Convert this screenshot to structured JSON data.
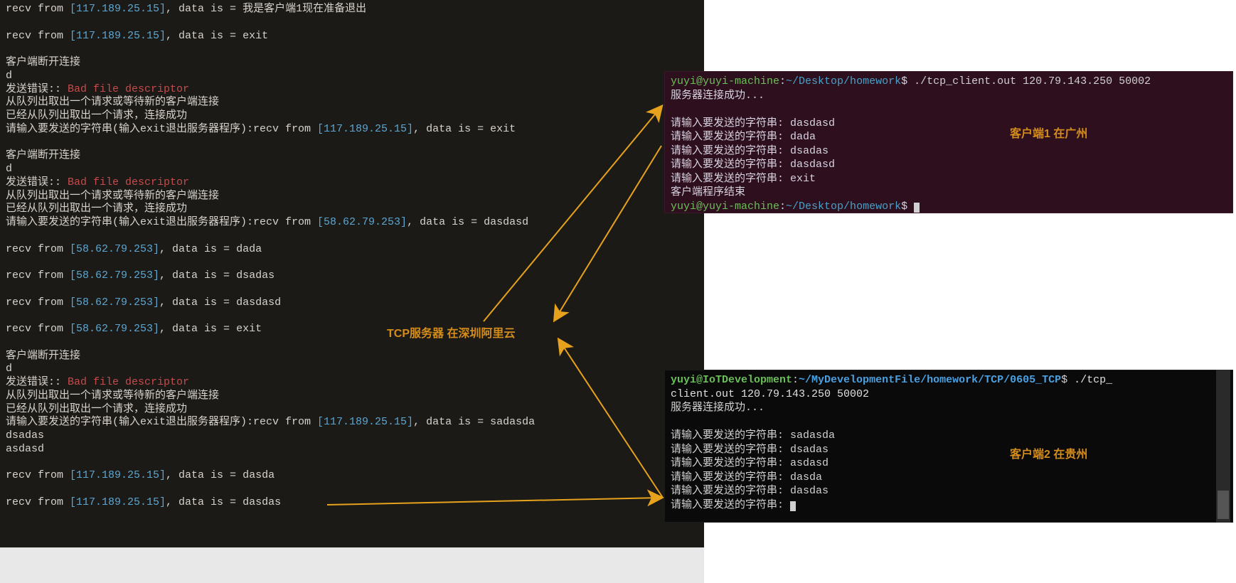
{
  "labels": {
    "server": "TCP服务器 在深圳阿里云",
    "client1": "客户端1 在广州",
    "client2": "客户端2 在贵州"
  },
  "ips": {
    "guizhou": "117.189.25.15",
    "guangzhou": "58.62.79.253",
    "server_addr": "120.79.143.250",
    "server_port": "50002"
  },
  "server_lines": [
    {
      "t": "recv",
      "ip": "117.189.25.15",
      "data": "我是客户端1现在准备退出"
    },
    {
      "t": "blank"
    },
    {
      "t": "recv",
      "ip": "117.189.25.15",
      "data": "exit"
    },
    {
      "t": "blank"
    },
    {
      "t": "plain",
      "text": "客户端断开连接"
    },
    {
      "t": "plain",
      "text": "d"
    },
    {
      "t": "err",
      "prefix": "发送错误::",
      "msg": " Bad file descriptor"
    },
    {
      "t": "plain",
      "text": "从队列出取出一个请求或等待新的客户端连接"
    },
    {
      "t": "plain",
      "text": "已经从队列出取出一个请求，连接成功"
    },
    {
      "t": "prompt_recv",
      "ip": "117.189.25.15",
      "data": "exit"
    },
    {
      "t": "blank"
    },
    {
      "t": "plain",
      "text": "客户端断开连接"
    },
    {
      "t": "plain",
      "text": "d"
    },
    {
      "t": "err",
      "prefix": "发送错误::",
      "msg": " Bad file descriptor"
    },
    {
      "t": "plain",
      "text": "从队列出取出一个请求或等待新的客户端连接"
    },
    {
      "t": "plain",
      "text": "已经从队列出取出一个请求，连接成功"
    },
    {
      "t": "prompt_recv",
      "ip": "58.62.79.253",
      "data": "dasdasd"
    },
    {
      "t": "blank"
    },
    {
      "t": "recv",
      "ip": "58.62.79.253",
      "data": "dada"
    },
    {
      "t": "blank"
    },
    {
      "t": "recv",
      "ip": "58.62.79.253",
      "data": "dsadas"
    },
    {
      "t": "blank"
    },
    {
      "t": "recv",
      "ip": "58.62.79.253",
      "data": "dasdasd"
    },
    {
      "t": "blank"
    },
    {
      "t": "recv",
      "ip": "58.62.79.253",
      "data": "exit"
    },
    {
      "t": "blank"
    },
    {
      "t": "plain",
      "text": "客户端断开连接"
    },
    {
      "t": "plain",
      "text": "d"
    },
    {
      "t": "err",
      "prefix": "发送错误::",
      "msg": " Bad file descriptor"
    },
    {
      "t": "plain",
      "text": "从队列出取出一个请求或等待新的客户端连接"
    },
    {
      "t": "plain",
      "text": "已经从队列出取出一个请求，连接成功"
    },
    {
      "t": "prompt_recv",
      "ip": "117.189.25.15",
      "data": "sadasda"
    },
    {
      "t": "plain",
      "text": "dsadas"
    },
    {
      "t": "plain",
      "text": "asdasd"
    },
    {
      "t": "blank"
    },
    {
      "t": "recv",
      "ip": "117.189.25.15",
      "data": "dasda"
    },
    {
      "t": "blank"
    },
    {
      "t": "recv",
      "ip": "117.189.25.15",
      "data": "dasdas"
    }
  ],
  "server_strings": {
    "recv_prefix": "recv from ",
    "data_is": ", data is = ",
    "prompt": "请输入要发送的字符串(输入exit退出服务器程序):"
  },
  "client1": {
    "user": "yuyi",
    "host": "yuyi-machine",
    "path": "~/Desktop/homework",
    "cmd": "./tcp_client.out 120.79.143.250 50002",
    "connect_ok": "服务器连接成功...",
    "prompt": "请输入要发送的字符串: ",
    "inputs": [
      "dasdasd",
      "dada",
      "dsadas",
      "dasdasd",
      "exit"
    ],
    "end": "客户端程序结束"
  },
  "client2": {
    "user": "yuyi",
    "host": "IoTDevelopment",
    "path": "~/MyDevelopmentFile/homework/TCP/0605_TCP",
    "cmd1": "./tcp_",
    "cmd2": "client.out 120.79.143.250 50002",
    "connect_ok": "服务器连接成功...",
    "prompt": "请输入要发送的字符串: ",
    "inputs": [
      "sadasda",
      "dsadas",
      "asdasd",
      "dasda",
      "dasdas"
    ]
  }
}
